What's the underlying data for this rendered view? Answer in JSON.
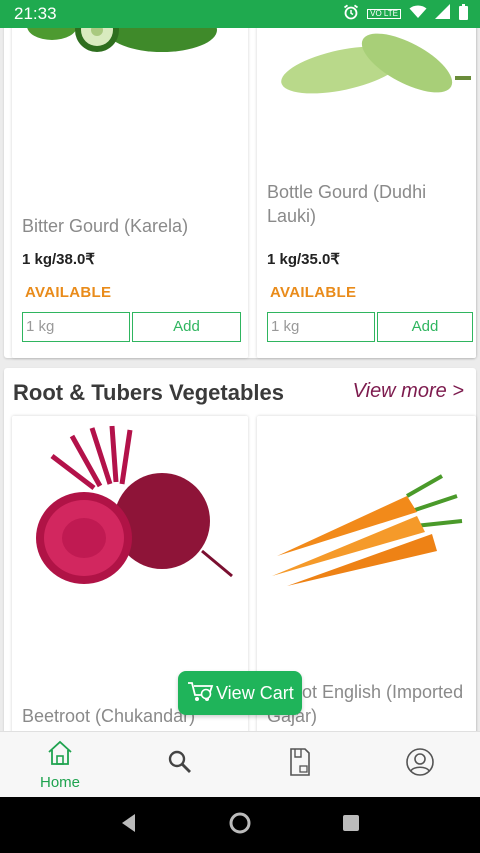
{
  "status_bar": {
    "time": "21:33",
    "network_badge": "VO LTE"
  },
  "section1": {
    "products": [
      {
        "name": "Bitter Gourd (Karela)",
        "price": "1 kg/38.0₹",
        "availability": "AVAILABLE",
        "qty_value": "1 kg",
        "add_label": "Add"
      },
      {
        "name": "Bottle Gourd (Dudhi Lauki)",
        "price": "1 kg/35.0₹",
        "availability": "AVAILABLE",
        "qty_value": "1 kg",
        "add_label": "Add"
      }
    ]
  },
  "section2": {
    "title": "Root & Tubers Vegetables",
    "view_more": "View more >",
    "products": [
      {
        "name": "Beetroot (Chukandar)"
      },
      {
        "name": "Carrot English (Imported Gajar)"
      }
    ]
  },
  "view_cart": {
    "label": "View Cart"
  },
  "bottom_nav": {
    "home_label": "Home"
  },
  "colors": {
    "brand_green": "#1faa4f",
    "available_orange": "#e98b1a",
    "view_more": "#7d1b4e"
  },
  "icons": [
    "alarm-icon",
    "wifi-icon",
    "signal-icon",
    "battery-icon",
    "home-icon",
    "search-icon",
    "orders-icon",
    "profile-icon",
    "cart-icon",
    "back-icon",
    "home-circle-icon",
    "recents-icon"
  ]
}
